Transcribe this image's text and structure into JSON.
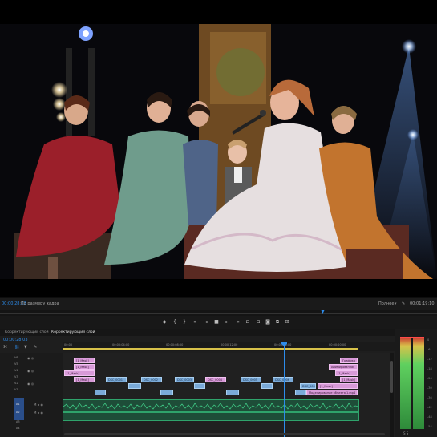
{
  "monitor": {
    "timecode": "00:00:28:03",
    "fit_label": "По размеру кадра",
    "quality_label": "Полное",
    "duration": "00:01:19:10"
  },
  "timeline": {
    "tabs": [
      "Корректирующий слой",
      "Корректирующий слой"
    ],
    "playhead_time": "00:00:28:03",
    "ruler": [
      "00:00",
      "00:00:04:00",
      "00:00:08:00",
      "00:00:12:00",
      "00:00:16:00",
      "00:00:20:00"
    ],
    "tracks": [
      "V6",
      "V5",
      "V4",
      "V3",
      "V2",
      "V1",
      "A1",
      "A2",
      "A3",
      "A4"
    ],
    "clips_top_left": [
      "[1_Mask]",
      "[1_Mask]",
      "[1_Mask]",
      "[1_Mask]"
    ],
    "clips_top_right": [
      "Графика",
      "Анимированная",
      "[1_Mask]",
      "[1_Mask]",
      "[1_Mask]"
    ],
    "clips_v2": [
      "DSC_0001",
      "DSC_0002",
      "DSC_0003",
      "DSC_0004",
      "DSC_0005",
      "DSC_0006",
      "DSC_0007"
    ],
    "clips_v1_labels": [
      "Сохранить вложенную п-Изменить",
      "Моделирование объекта 1.mp4"
    ]
  },
  "meters": {
    "scale": [
      "0",
      "-6",
      "-12",
      "-18",
      "-24",
      "-30",
      "-36",
      "-42",
      "-48",
      "-54"
    ],
    "bottom": "S S"
  },
  "colors": {
    "accent": "#2d8ceb",
    "pink_clip": "#d89ad8",
    "blue_clip": "#7aaad8",
    "audio_wave": "#2fa36b"
  }
}
